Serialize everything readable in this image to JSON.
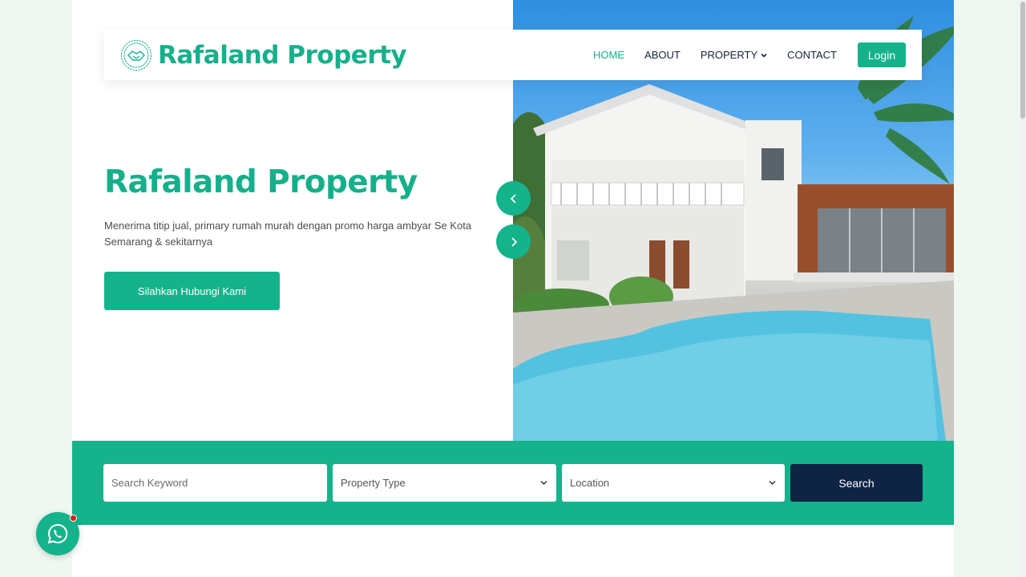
{
  "brand": {
    "name": "Rafaland Property",
    "logo_icon": "handshake-logo-icon",
    "color": "#15b08b"
  },
  "nav": {
    "items": [
      {
        "label": "HOME",
        "active": true
      },
      {
        "label": "ABOUT"
      },
      {
        "label": "PROPERTY",
        "dropdown": true
      },
      {
        "label": "CONTACT"
      }
    ],
    "login_label": "Login"
  },
  "hero": {
    "title": "Rafaland Property",
    "description": "Menerima titip jual, primary rumah murah dengan promo harga ambyar Se Kota Semarang & sekitarnya",
    "cta_label": "Silahkan Hubungi Kami",
    "prev_icon": "chevron-left-icon",
    "next_icon": "chevron-right-icon"
  },
  "search": {
    "keyword_placeholder": "Search Keyword",
    "property_type_value": "Property Type",
    "location_value": "Location",
    "button_label": "Search"
  },
  "whatsapp": {
    "icon": "whatsapp-icon",
    "notification": true
  },
  "colors": {
    "accent": "#14b38b",
    "dark": "#0f2345",
    "notification": "#e01b1b"
  }
}
